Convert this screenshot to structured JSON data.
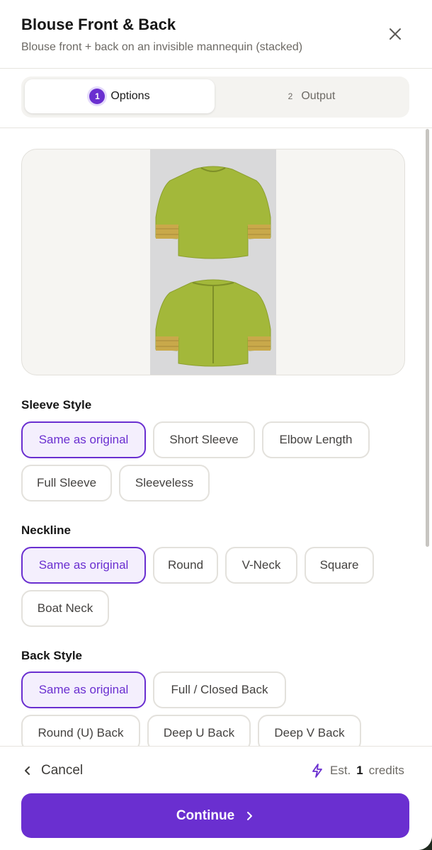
{
  "header": {
    "title": "Blouse Front & Back",
    "subtitle": "Blouse front + back on an invisible mannequin (stacked)"
  },
  "steps": [
    {
      "number": "1",
      "label": "Options",
      "active": true
    },
    {
      "number": "2",
      "label": "Output",
      "active": false
    }
  ],
  "sleeve_style": {
    "label": "Sleeve Style",
    "options": [
      "Same as original",
      "Short Sleeve",
      "Elbow Length",
      "Full Sleeve",
      "Sleeveless"
    ],
    "selected": "Same as original"
  },
  "neckline": {
    "label": "Neckline",
    "options": [
      "Same as original",
      "Round",
      "V-Neck",
      "Square",
      "Boat Neck"
    ],
    "selected": "Same as original"
  },
  "back_style": {
    "label": "Back Style",
    "options": [
      "Same as original",
      "Full / Closed Back",
      "Round (U) Back",
      "Deep U Back",
      "Deep V Back"
    ],
    "selected": "Same as original"
  },
  "footer": {
    "cancel_label": "Cancel",
    "credits_prefix": "Est.",
    "credits_value": "1",
    "credits_suffix": "credits",
    "continue_label": "Continue"
  },
  "icons": {
    "close": "close-icon",
    "cancel": "chevron-left-icon",
    "credits": "lightning-icon",
    "continue": "chevron-right-icon"
  },
  "colors": {
    "accent": "#6a2fd0",
    "accent_light": "#f4effd",
    "blouse": "#a3b83a",
    "border": "#e3e1dc"
  }
}
